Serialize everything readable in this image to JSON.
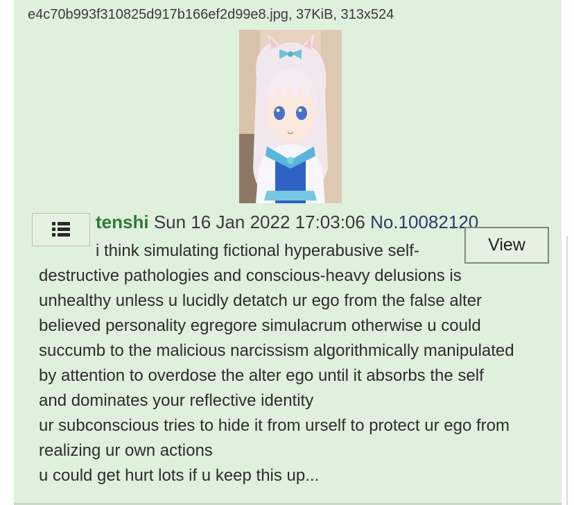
{
  "file": {
    "info": "e4c70b993f310825d917b166ef2d99e8.jpg, 37KiB, 313x524",
    "thumbnail_icon": "anime-catgirl-thumbnail"
  },
  "post": {
    "menu_icon": "list-menu-icon",
    "name": "tenshi",
    "datetime": "Sun 16 Jan 2022 17:03:06",
    "number": "No.10082120",
    "view_label": "View",
    "body_lines": [
      "i think simulating fictional hyperabusive self-",
      "destructive pathologies and conscious-heavy delusions is",
      "unhealthy unless u lucidly detatch ur ego from the false alter",
      "believed personality egregore simulacrum otherwise u could",
      "succumb to the malicious narcissism algorithmically manipulated",
      "by attention to overdose the alter ego until it absorbs the self",
      "and dominates your reflective identity",
      "ur subconscious tries to hide it from urself to protect ur ego from",
      "realizing ur own actions",
      "u could get hurt lots if u keep this up..."
    ]
  },
  "colors": {
    "post_background": "#dff0dc",
    "name": "#2f7a3a",
    "post_number": "#2b3b6b"
  }
}
